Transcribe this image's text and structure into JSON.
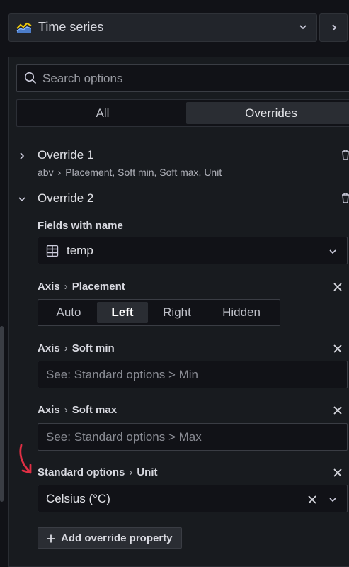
{
  "header": {
    "viz_name": "Time series",
    "viz_icon": "time-series-icon",
    "dropdown_icon": "chevron-down-icon",
    "next_icon": "chevron-right-icon"
  },
  "search": {
    "placeholder": "Search options",
    "icon": "search-icon"
  },
  "tabs": [
    {
      "label": "All",
      "active": false
    },
    {
      "label": "Overrides",
      "active": true
    }
  ],
  "override1": {
    "title": "Override 1",
    "field": "abv",
    "summary": "Placement, Soft min, Soft max, Unit",
    "expanded": false
  },
  "override2": {
    "title": "Override 2",
    "expanded": true,
    "matcher_label": "Fields with name",
    "matcher_value": "temp",
    "props": {
      "placement": {
        "category": "Axis",
        "name": "Placement",
        "options": [
          "Auto",
          "Left",
          "Right",
          "Hidden"
        ],
        "selected": "Left"
      },
      "softmin": {
        "category": "Axis",
        "name": "Soft min",
        "placeholder": "See: Standard options > Min"
      },
      "softmax": {
        "category": "Axis",
        "name": "Soft max",
        "placeholder": "See: Standard options > Max"
      },
      "unit": {
        "category": "Standard options",
        "name": "Unit",
        "value": "Celsius (°C)"
      }
    },
    "add_button": "Add override property"
  },
  "colors": {
    "background": "#111217",
    "panel": "#181b1f",
    "accent_arrow": "#e02f44"
  }
}
